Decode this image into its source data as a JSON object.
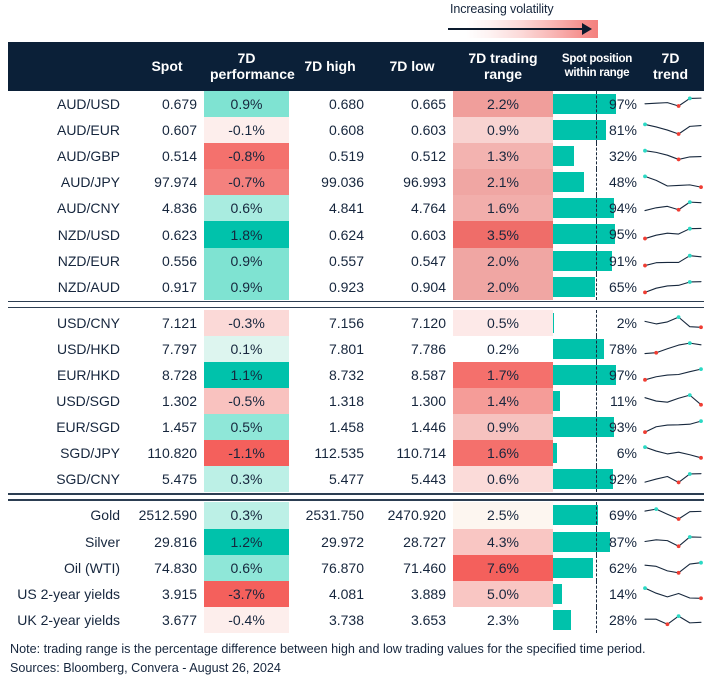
{
  "legend": {
    "label": "Increasing volatility",
    "gradient_from": "#ffffff",
    "gradient_to": "#f4817e"
  },
  "columns": {
    "name": "",
    "spot": "Spot",
    "performance": "7D performance",
    "performance_l1": "7D",
    "performance_l2": "performance",
    "high": "7D high",
    "low": "7D low",
    "range_l1": "7D trading",
    "range_l2": "range",
    "position_l1": "Spot position",
    "position_l2": "within range",
    "trend": "7D trend"
  },
  "colors": {
    "header_bg": "#0b2038",
    "bar": "#00c2ab",
    "positive_strong": "#00c2ab",
    "negative_strong": "#f4605c",
    "text": "#16263d",
    "spark_line": "#17283d",
    "spark_high": "#2bd9c4",
    "spark_low": "#ef3d33"
  },
  "sections": [
    {
      "name": "antipodean-fx",
      "rows": [
        {
          "name": "AUD/USD",
          "spot": "0.679",
          "perf": "0.9%",
          "perf_bg": "#7fe3d2",
          "high": "0.680",
          "low": "0.665",
          "range": "2.2%",
          "range_bg": "#f09e9b",
          "pos": "97%",
          "pos_pct": 97,
          "spark": [
            0.52,
            0.56,
            0.6,
            0.36,
            0.9,
            0.92
          ],
          "high_idx": 4,
          "low_idx": 3
        },
        {
          "name": "AUD/EUR",
          "spot": "0.607",
          "perf": "-0.1%",
          "perf_bg": "#fdeeec",
          "high": "0.608",
          "low": "0.603",
          "range": "0.9%",
          "range_bg": "#f8d3d1",
          "pos": "81%",
          "pos_pct": 81,
          "spark": [
            0.9,
            0.72,
            0.5,
            0.22,
            0.76,
            0.82
          ],
          "high_idx": 0,
          "low_idx": 3
        },
        {
          "name": "AUD/GBP",
          "spot": "0.514",
          "perf": "-0.8%",
          "perf_bg": "#f4716d",
          "high": "0.519",
          "low": "0.512",
          "range": "1.3%",
          "range_bg": "#f3b3b0",
          "pos": "32%",
          "pos_pct": 32,
          "spark": [
            0.88,
            0.76,
            0.56,
            0.26,
            0.44,
            0.46
          ],
          "high_idx": 0,
          "low_idx": 3
        },
        {
          "name": "AUD/JPY",
          "spot": "97.974",
          "perf": "-0.7%",
          "perf_bg": "#f4817e",
          "high": "99.036",
          "low": "96.993",
          "range": "2.1%",
          "range_bg": "#f0a6a3",
          "pos": "48%",
          "pos_pct": 48,
          "spark": [
            0.9,
            0.62,
            0.22,
            0.26,
            0.3,
            0.14
          ],
          "high_idx": 0,
          "low_idx": 5
        },
        {
          "name": "AUD/CNY",
          "spot": "4.836",
          "perf": "0.6%",
          "perf_bg": "#a9ece0",
          "high": "4.841",
          "low": "4.764",
          "range": "1.6%",
          "range_bg": "#f2aeab",
          "pos": "94%",
          "pos_pct": 94,
          "spark": [
            0.32,
            0.52,
            0.62,
            0.38,
            0.92,
            0.88
          ],
          "high_idx": 4,
          "low_idx": 3
        },
        {
          "name": "NZD/USD",
          "spot": "0.623",
          "perf": "1.8%",
          "perf_bg": "#00c2ab",
          "high": "0.624",
          "low": "0.603",
          "range": "3.5%",
          "range_bg": "#ef6d69",
          "pos": "95%",
          "pos_pct": 95,
          "spark": [
            0.18,
            0.42,
            0.56,
            0.5,
            0.88,
            0.9
          ],
          "high_idx": 4,
          "low_idx": 0
        },
        {
          "name": "NZD/EUR",
          "spot": "0.556",
          "perf": "0.9%",
          "perf_bg": "#7fe3d2",
          "high": "0.557",
          "low": "0.547",
          "range": "2.0%",
          "range_bg": "#f0a6a3",
          "pos": "91%",
          "pos_pct": 91,
          "spark": [
            0.18,
            0.38,
            0.4,
            0.4,
            0.88,
            0.8
          ],
          "high_idx": 4,
          "low_idx": 0
        },
        {
          "name": "NZD/AUD",
          "spot": "0.917",
          "perf": "0.9%",
          "perf_bg": "#7fe3d2",
          "high": "0.923",
          "low": "0.904",
          "range": "2.0%",
          "range_bg": "#f0a6a3",
          "pos": "65%",
          "pos_pct": 65,
          "spark": [
            0.12,
            0.42,
            0.58,
            0.62,
            0.86,
            0.88
          ],
          "high_idx": 4,
          "low_idx": 0
        }
      ]
    },
    {
      "name": "asian-fx",
      "rows": [
        {
          "name": "USD/CNY",
          "spot": "7.121",
          "perf": "-0.3%",
          "perf_bg": "#fbd9d7",
          "high": "7.156",
          "low": "7.120",
          "range": "0.5%",
          "range_bg": "#fde9e8",
          "pos": "2%",
          "pos_pct": 2,
          "spark": [
            0.62,
            0.44,
            0.58,
            0.92,
            0.24,
            0.2
          ],
          "high_idx": 3,
          "low_idx": 5
        },
        {
          "name": "USD/HKD",
          "spot": "7.797",
          "perf": "0.1%",
          "perf_bg": "#ddf5ef",
          "high": "7.801",
          "low": "7.786",
          "range": "0.2%",
          "range_bg": "#ffffff",
          "pos": "78%",
          "pos_pct": 78,
          "spark": [
            0.18,
            0.24,
            0.52,
            0.78,
            0.92,
            0.8
          ],
          "high_idx": 4,
          "low_idx": 1
        },
        {
          "name": "EUR/HKD",
          "spot": "8.728",
          "perf": "1.1%",
          "perf_bg": "#00c2ab",
          "high": "8.732",
          "low": "8.587",
          "range": "1.7%",
          "range_bg": "#f4706c",
          "pos": "97%",
          "pos_pct": 97,
          "spark": [
            0.16,
            0.38,
            0.5,
            0.54,
            0.74,
            0.92
          ],
          "high_idx": 5,
          "low_idx": 0
        },
        {
          "name": "USD/SGD",
          "spot": "1.302",
          "perf": "-0.5%",
          "perf_bg": "#f9c2bf",
          "high": "1.318",
          "low": "1.300",
          "range": "1.4%",
          "range_bg": "#f59c98",
          "pos": "11%",
          "pos_pct": 11,
          "spark": [
            0.74,
            0.5,
            0.42,
            0.7,
            0.92,
            0.24
          ],
          "high_idx": 4,
          "low_idx": 5
        },
        {
          "name": "EUR/SGD",
          "spot": "1.457",
          "perf": "0.5%",
          "perf_bg": "#8fe7d8",
          "high": "1.458",
          "low": "1.446",
          "range": "0.9%",
          "range_bg": "#f6c2bf",
          "pos": "93%",
          "pos_pct": 93,
          "spark": [
            0.14,
            0.52,
            0.64,
            0.66,
            0.7,
            0.92
          ],
          "high_idx": 5,
          "low_idx": 0
        },
        {
          "name": "SGD/JPY",
          "spot": "110.820",
          "perf": "-1.1%",
          "perf_bg": "#f4605c",
          "high": "112.535",
          "low": "110.714",
          "range": "1.6%",
          "range_bg": "#f4706c",
          "pos": "6%",
          "pos_pct": 6,
          "spark": [
            0.92,
            0.64,
            0.44,
            0.56,
            0.38,
            0.16
          ],
          "high_idx": 0,
          "low_idx": 5
        },
        {
          "name": "SGD/CNY",
          "spot": "5.475",
          "perf": "0.3%",
          "perf_bg": "#bcf0e6",
          "high": "5.477",
          "low": "5.443",
          "range": "0.6%",
          "range_bg": "#fbdbd9",
          "pos": "92%",
          "pos_pct": 92,
          "spark": [
            0.28,
            0.5,
            0.68,
            0.26,
            0.86,
            0.88
          ],
          "high_idx": 4,
          "low_idx": 3
        }
      ]
    },
    {
      "name": "commodities-and-yields",
      "rows": [
        {
          "name": "Gold",
          "spot": "2512.590",
          "perf": "0.3%",
          "perf_bg": "#bcf0e6",
          "high": "2531.750",
          "low": "2470.920",
          "range": "2.5%",
          "range_bg": "#fdf6f0",
          "pos": "69%",
          "pos_pct": 69,
          "spark": [
            0.78,
            0.92,
            0.56,
            0.22,
            0.74,
            0.76
          ],
          "high_idx": 1,
          "low_idx": 3
        },
        {
          "name": "Silver",
          "spot": "29.816",
          "perf": "1.2%",
          "perf_bg": "#00c2ab",
          "high": "29.972",
          "low": "28.727",
          "range": "4.3%",
          "range_bg": "#f9c6c3",
          "pos": "87%",
          "pos_pct": 87,
          "spark": [
            0.54,
            0.66,
            0.6,
            0.2,
            0.86,
            0.84
          ],
          "high_idx": 4,
          "low_idx": 3
        },
        {
          "name": "Oil (WTI)",
          "spot": "74.830",
          "perf": "0.6%",
          "perf_bg": "#8fe7d8",
          "high": "76.870",
          "low": "71.460",
          "range": "7.6%",
          "range_bg": "#f4605c",
          "pos": "62%",
          "pos_pct": 62,
          "spark": [
            0.7,
            0.62,
            0.3,
            0.16,
            0.78,
            0.88
          ],
          "high_idx": 5,
          "low_idx": 3
        },
        {
          "name": "US 2-year yields",
          "spot": "3.915",
          "perf": "-3.7%",
          "perf_bg": "#f4605c",
          "high": "4.081",
          "low": "3.889",
          "range": "5.0%",
          "range_bg": "#f9c6c3",
          "pos": "14%",
          "pos_pct": 14,
          "spark": [
            0.92,
            0.56,
            0.3,
            0.54,
            0.22,
            0.2
          ],
          "high_idx": 0,
          "low_idx": 5
        },
        {
          "name": "UK 2-year yields",
          "spot": "3.677",
          "perf": "-0.4%",
          "perf_bg": "#fdeeec",
          "high": "3.738",
          "low": "3.653",
          "range": "2.3%",
          "range_bg": "#ffffff",
          "pos": "28%",
          "pos_pct": 28,
          "spark": [
            0.56,
            0.56,
            0.2,
            0.78,
            0.3,
            0.34
          ],
          "high_idx": 3,
          "low_idx": 2
        }
      ]
    }
  ],
  "footer": {
    "note": "Note: trading range is the percentage difference between high and low trading values for the specified time period.",
    "sources": "Sources: Bloomberg, Convera - August 26, 2024"
  }
}
